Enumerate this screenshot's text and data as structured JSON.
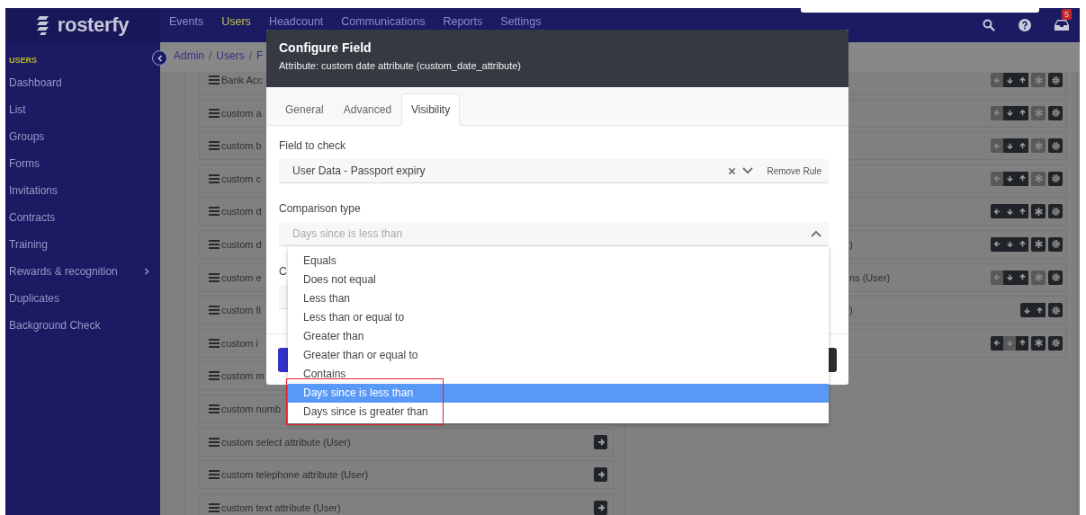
{
  "brand": {
    "name": "rosterfy"
  },
  "nav": [
    {
      "label": "Events",
      "selected": false
    },
    {
      "label": "Users",
      "selected": true
    },
    {
      "label": "Headcount",
      "selected": false
    },
    {
      "label": "Communications",
      "selected": false
    },
    {
      "label": "Reports",
      "selected": false
    },
    {
      "label": "Settings",
      "selected": false
    }
  ],
  "notifications": {
    "count": "5"
  },
  "sidebar": {
    "section": "USERS",
    "items": [
      {
        "label": "Dashboard",
        "has_submenu": false
      },
      {
        "label": "List",
        "has_submenu": false
      },
      {
        "label": "Groups",
        "has_submenu": false
      },
      {
        "label": "Forms",
        "has_submenu": false
      },
      {
        "label": "Invitations",
        "has_submenu": false
      },
      {
        "label": "Contracts",
        "has_submenu": false
      },
      {
        "label": "Training",
        "has_submenu": false
      },
      {
        "label": "Rewards & recognition",
        "has_submenu": true
      },
      {
        "label": "Duplicates",
        "has_submenu": false
      },
      {
        "label": "Background Check",
        "has_submenu": false
      }
    ]
  },
  "breadcrumb": {
    "separator": "/",
    "items": [
      "Admin",
      "Users",
      "F"
    ]
  },
  "field_list": [
    {
      "label": "Bank Acc",
      "kind": "partial"
    },
    {
      "label": "custom a",
      "kind": "partial"
    },
    {
      "label": "custom b",
      "kind": "partial"
    },
    {
      "label": "custom c",
      "kind": "partial"
    },
    {
      "label": "custom d",
      "kind": "partial"
    },
    {
      "label": "custom d",
      "kind": "partial"
    },
    {
      "label": "custom e",
      "kind": "partial"
    },
    {
      "label": "custom fi",
      "kind": "partial"
    },
    {
      "label": "custom i",
      "kind": "partial"
    },
    {
      "label": "custom m",
      "kind": "partial"
    },
    {
      "label": "custom numb",
      "kind": "partial"
    },
    {
      "label": "custom select attribute (User)",
      "kind": "full"
    },
    {
      "label": "custom telephone attribute (User)",
      "kind": "full"
    },
    {
      "label": "custom text attribute (User)",
      "kind": "full"
    }
  ],
  "right_list": [
    {
      "buttons": [
        {
          "kind": "left",
          "disabled": true
        },
        {
          "kind": "down",
          "disabled": false
        },
        {
          "kind": "up",
          "disabled": false
        },
        {
          "kind": "asterisk",
          "disabled": true
        },
        {
          "kind": "gear",
          "disabled": false
        }
      ]
    },
    {
      "buttons": [
        {
          "kind": "left",
          "disabled": true
        },
        {
          "kind": "down",
          "disabled": false
        },
        {
          "kind": "up",
          "disabled": false
        },
        {
          "kind": "asterisk",
          "disabled": true
        },
        {
          "kind": "gear",
          "disabled": false
        }
      ]
    },
    {
      "buttons": [
        {
          "kind": "left",
          "disabled": true
        },
        {
          "kind": "down",
          "disabled": false
        },
        {
          "kind": "up",
          "disabled": false
        },
        {
          "kind": "asterisk",
          "disabled": true
        },
        {
          "kind": "gear",
          "disabled": false
        }
      ]
    },
    {
      "buttons": [
        {
          "kind": "left",
          "disabled": true
        },
        {
          "kind": "down",
          "disabled": false
        },
        {
          "kind": "up",
          "disabled": false
        },
        {
          "kind": "asterisk",
          "disabled": true
        },
        {
          "kind": "gear",
          "disabled": false
        }
      ]
    },
    {
      "buttons": [
        {
          "kind": "left",
          "disabled": false
        },
        {
          "kind": "down",
          "disabled": false
        },
        {
          "kind": "up",
          "disabled": false
        },
        {
          "kind": "asterisk",
          "disabled": false
        },
        {
          "kind": "gear",
          "disabled": false
        }
      ]
    },
    {
      "label": ")",
      "buttons": [
        {
          "kind": "left",
          "disabled": false
        },
        {
          "kind": "down",
          "disabled": false
        },
        {
          "kind": "up",
          "disabled": false
        },
        {
          "kind": "asterisk",
          "disabled": false
        },
        {
          "kind": "gear",
          "disabled": false
        }
      ]
    },
    {
      "label": "ns (User)",
      "buttons": [
        {
          "kind": "left",
          "disabled": true
        },
        {
          "kind": "down",
          "disabled": false
        },
        {
          "kind": "up",
          "disabled": false
        },
        {
          "kind": "asterisk",
          "disabled": true
        },
        {
          "kind": "gear",
          "disabled": false
        }
      ]
    },
    {
      "label": ")",
      "buttons": [
        {
          "kind": "down",
          "disabled": false
        },
        {
          "kind": "up",
          "disabled": false
        },
        {
          "kind": "gear",
          "disabled": false
        }
      ]
    },
    {
      "buttons": [
        {
          "kind": "left",
          "disabled": false
        },
        {
          "kind": "down",
          "disabled": true
        },
        {
          "kind": "up",
          "disabled": false
        },
        {
          "kind": "asterisk",
          "disabled": false
        },
        {
          "kind": "gear",
          "disabled": false
        }
      ]
    }
  ],
  "dialog": {
    "title": "Configure Field",
    "subtitle": "Attribute: custom date attribute (custom_date_attribute)",
    "tabs": [
      {
        "label": "General",
        "selected": false
      },
      {
        "label": "Advanced",
        "selected": false
      },
      {
        "label": "Visibility",
        "selected": true
      }
    ],
    "fields": [
      {
        "label": "Field to check",
        "value": "User Data - Passport expiry",
        "action": "Remove Rule",
        "expanded": false
      },
      {
        "label": "Comparison type",
        "value": "Days since is less than",
        "expanded": true,
        "options": [
          {
            "label": "Equals",
            "selected": false
          },
          {
            "label": "Does not equal",
            "selected": false
          },
          {
            "label": "Less than",
            "selected": false
          },
          {
            "label": "Less than or equal to",
            "selected": false
          },
          {
            "label": "Greater than",
            "selected": false
          },
          {
            "label": "Greater than or equal to",
            "selected": false
          },
          {
            "label": "Contains",
            "selected": false
          },
          {
            "label": "Days since is less than",
            "selected": true
          },
          {
            "label": "Days since is greater than",
            "selected": false
          }
        ]
      },
      {
        "label": "C"
      }
    ]
  }
}
